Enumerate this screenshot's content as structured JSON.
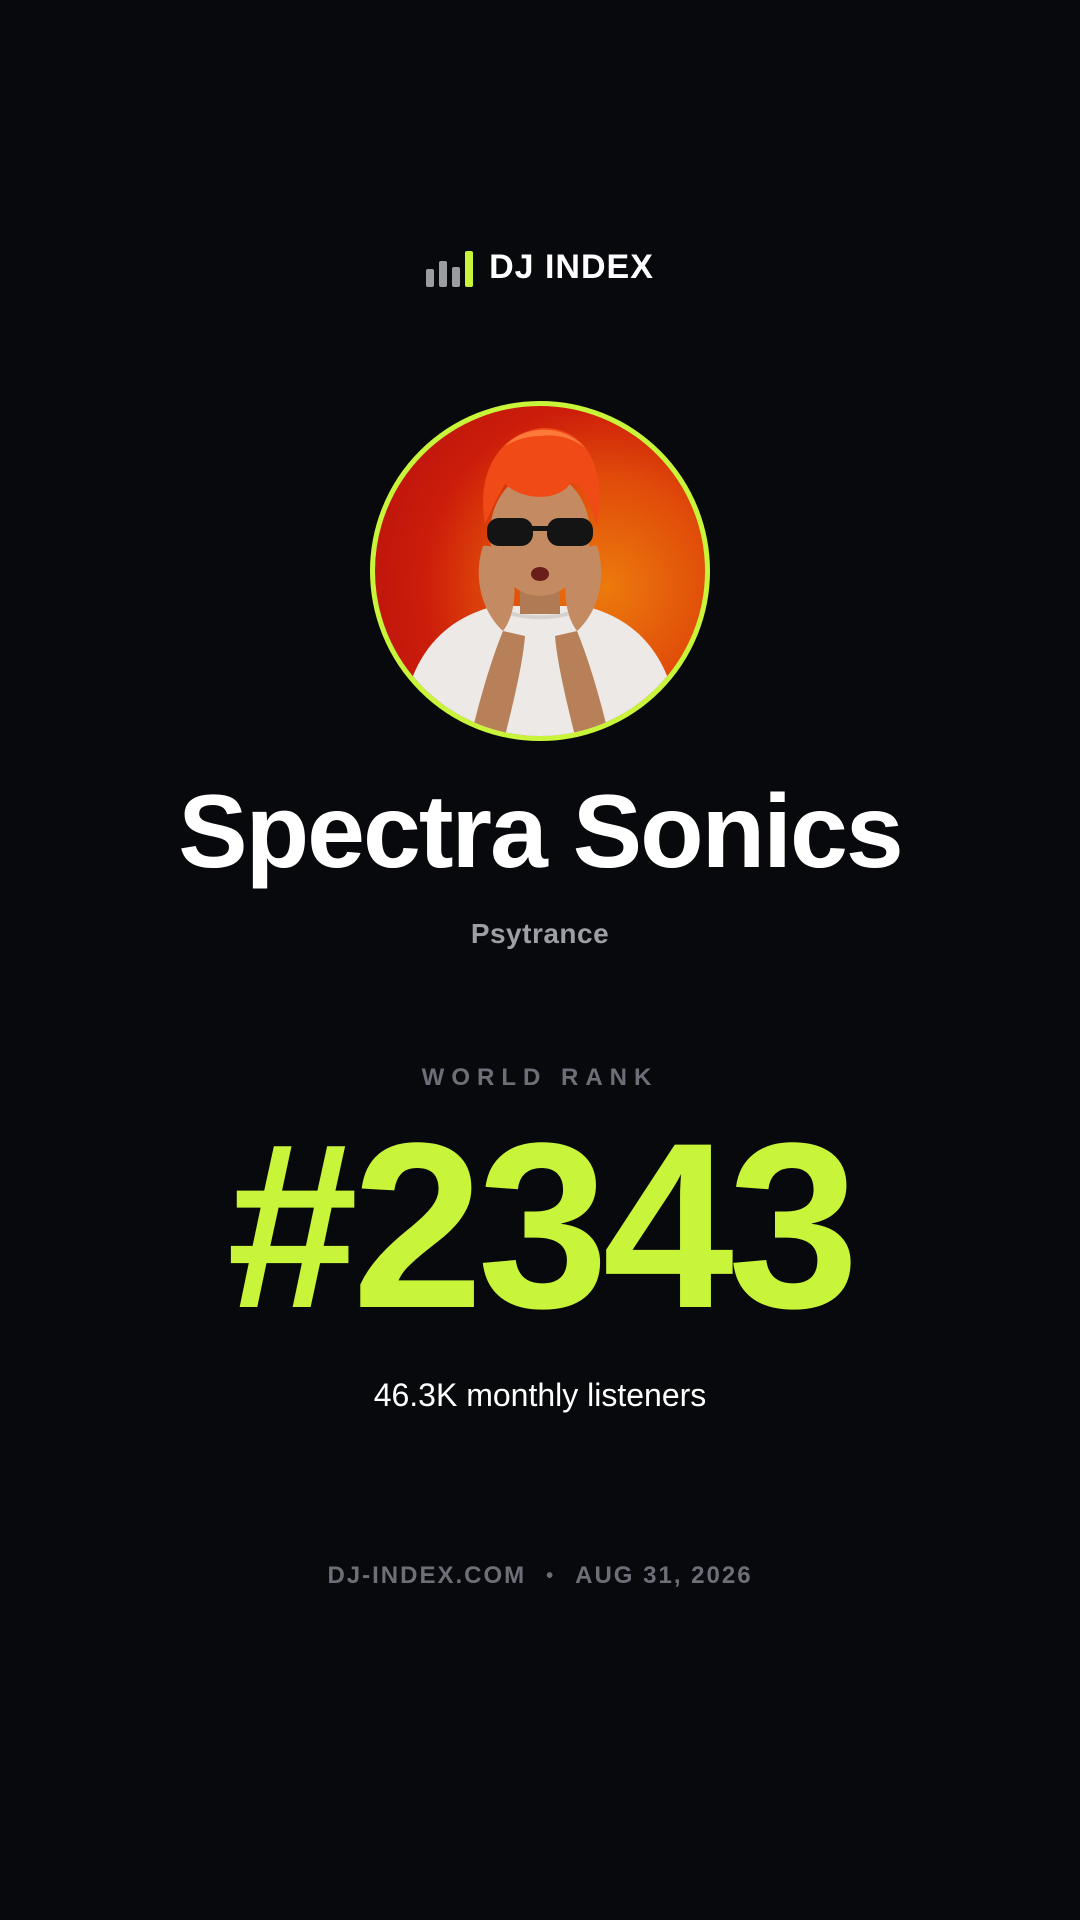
{
  "brand": {
    "name": "DJ INDEX",
    "icon": "equalizer-bars-icon",
    "accent_color": "#c8f53a"
  },
  "artist": {
    "avatar_icon": "artist-photo",
    "name": "Spectra Sonics",
    "genre": "Psytrance"
  },
  "rank": {
    "label": "WORLD RANK",
    "value": "#2343",
    "listeners": "46.3K monthly listeners"
  },
  "footer": {
    "site": "DJ-INDEX.COM",
    "separator": "•",
    "date": "AUG 31, 2026"
  },
  "colors": {
    "background": "#08090c",
    "accent": "#c8f53a",
    "muted_text": "#6c6f77",
    "genre_text": "#9d9fa6"
  }
}
